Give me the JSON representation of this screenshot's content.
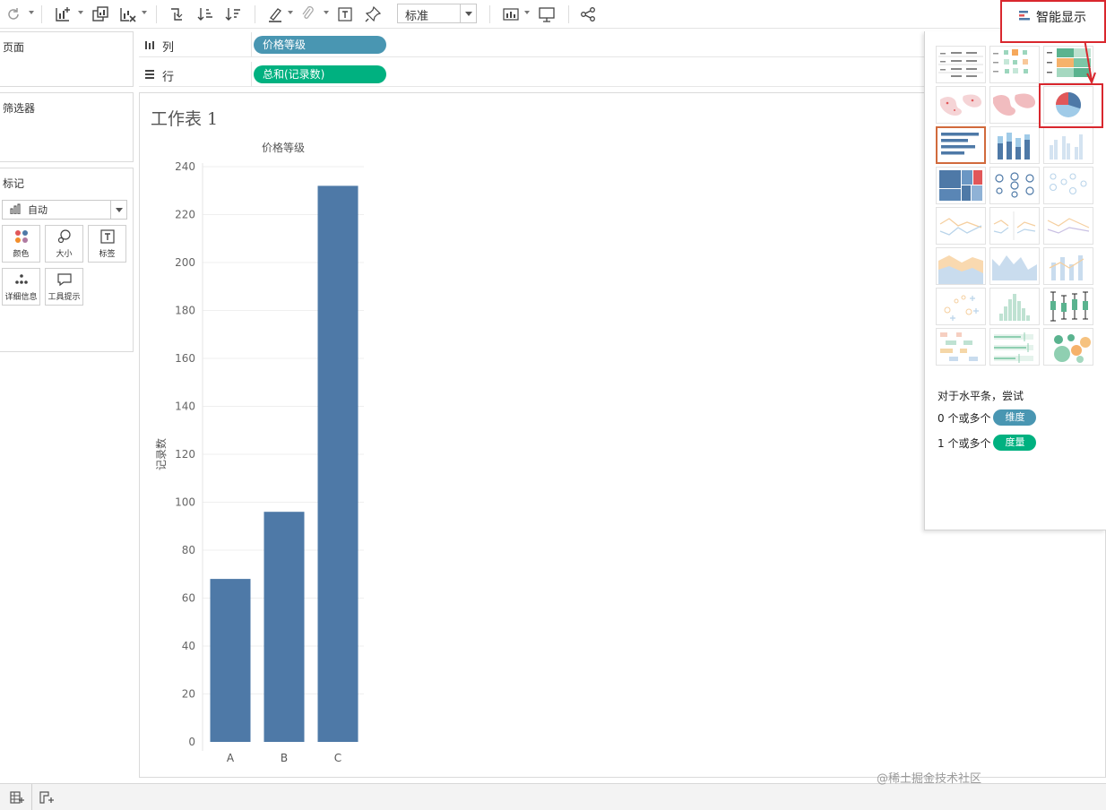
{
  "toolbar": {
    "standard_select": "标准"
  },
  "smart_display": {
    "tab_label": "智能显示",
    "hint": "对于水平条，尝试",
    "dim_prefix": "0 个或多个",
    "dim_label": "维度",
    "meas_prefix": "1 个或多个",
    "meas_label": "度量"
  },
  "panels": {
    "pages": "页面",
    "filters": "筛选器",
    "marks": "标记",
    "marks_type": "自动",
    "marks_buttons": [
      "颜色",
      "大小",
      "标签",
      "详细信息",
      "工具提示"
    ]
  },
  "shelves": {
    "columns_label": "列",
    "columns_pill": "价格等级",
    "rows_label": "行",
    "rows_pill": "总和(记录数)"
  },
  "sheet": {
    "title": "工作表 1"
  },
  "chart_data": {
    "type": "bar",
    "title": "价格等级",
    "xlabel": "",
    "ylabel": "记录数",
    "categories": [
      "A",
      "B",
      "C"
    ],
    "values": [
      68,
      96,
      232
    ],
    "ylim": [
      0,
      240
    ],
    "yticks": [
      0,
      20,
      40,
      60,
      80,
      100,
      120,
      140,
      160,
      180,
      200,
      220,
      240
    ],
    "grid": true,
    "bar_color": "#4e79a7"
  },
  "colors": {
    "dimension": "#4996b2",
    "measure": "#00b180",
    "highlight": "#d9272e"
  },
  "watermark": "@稀土掘金技术社区"
}
